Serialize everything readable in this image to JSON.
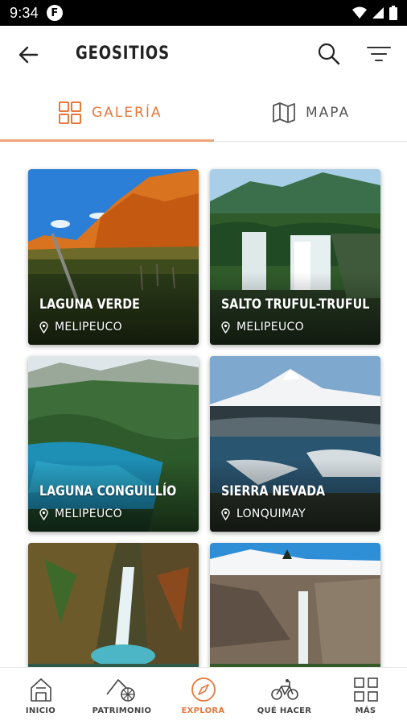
{
  "status_bar": {
    "time": "9:34",
    "app_badge": "F"
  },
  "header": {
    "title": "GEOSITIOS"
  },
  "tabs": [
    {
      "label": "GALERÍA",
      "active": true
    },
    {
      "label": "MAPA",
      "active": false
    }
  ],
  "colors": {
    "accent": "#e8773c",
    "tab_indicator": "#f0a37a"
  },
  "sites": [
    {
      "name": "LAGUNA VERDE",
      "location": "MELIPEUCO"
    },
    {
      "name": "SALTO TRUFUL-TRUFUL",
      "location": "MELIPEUCO"
    },
    {
      "name": "LAGUNA CONGUILLÍO",
      "location": "MELIPEUCO"
    },
    {
      "name": "SIERRA NEVADA",
      "location": "LONQUIMAY"
    }
  ],
  "bottom_nav": [
    {
      "label": "INICIO",
      "icon": "house-icon",
      "active": false
    },
    {
      "label": "PATRIMONIO",
      "icon": "heritage-icon",
      "active": false
    },
    {
      "label": "EXPLORA",
      "icon": "compass-icon",
      "active": true
    },
    {
      "label": "QUÉ HACER",
      "icon": "bicycle-icon",
      "active": false
    },
    {
      "label": "MÁS",
      "icon": "grid-icon",
      "active": false
    }
  ]
}
